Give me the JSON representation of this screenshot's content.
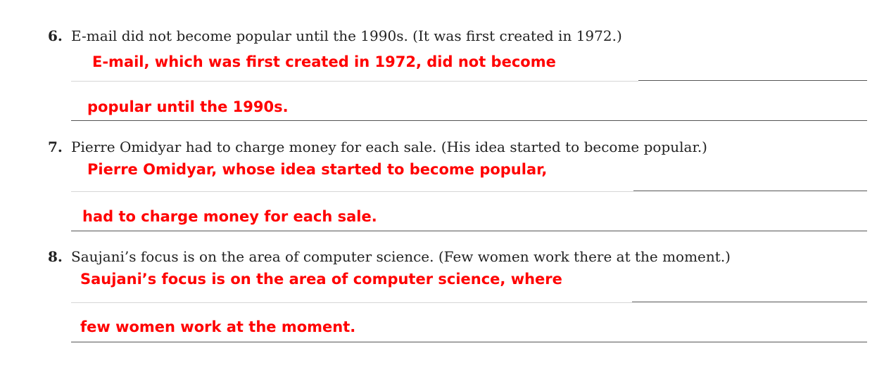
{
  "items": [
    {
      "number": "6.",
      "prompt": "E-mail did not become popular until the 1990s. (It was first created in 1972.)",
      "answer_line1": "E-mail, which was first created in 1972, did not become",
      "answer_line2": "popular until the 1990s."
    },
    {
      "number": "7.",
      "prompt": "Pierre Omidyar had to charge money for each sale. (His idea started to become popular.)",
      "answer_line1": "Pierre Omidyar, whose idea started to become popular,",
      "answer_line2": "had to charge money for each sale."
    },
    {
      "number": "8.",
      "prompt": "Saujani’s focus is on the area of computer science. (Few women work there at the moment.)",
      "answer_line1": "Saujani’s focus is on the area of computer science, where",
      "answer_line2": "few women work at the moment."
    }
  ],
  "colors": {
    "prompt_text": "#222222",
    "answer_text": "#ff0000",
    "rule_dark": "#555555",
    "rule_light": "#d6d6d6"
  }
}
